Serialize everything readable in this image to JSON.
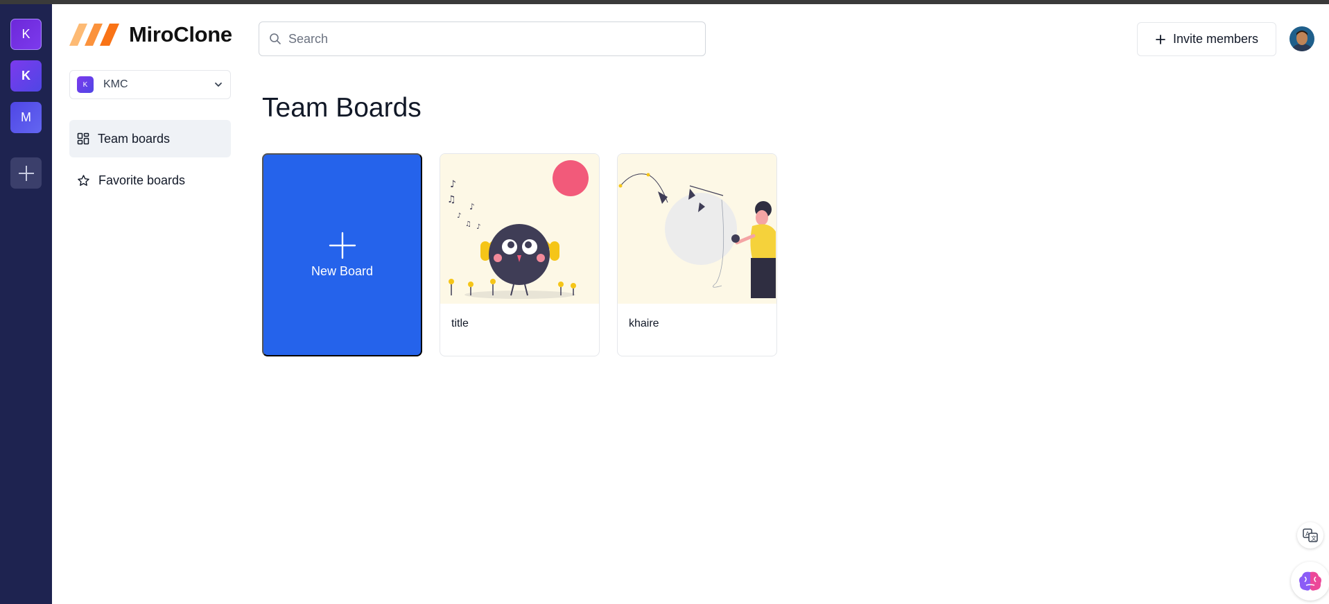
{
  "app": {
    "name": "MiroClone"
  },
  "org_rail": {
    "orgs": [
      {
        "initial": "K"
      },
      {
        "initial": "K"
      },
      {
        "initial": "M"
      }
    ],
    "add_label": "+"
  },
  "org_switcher": {
    "initial": "K",
    "name": "KMC"
  },
  "nav": {
    "team_boards": "Team boards",
    "favorite_boards": "Favorite boards"
  },
  "search": {
    "placeholder": "Search",
    "value": ""
  },
  "header": {
    "invite_label": "Invite members"
  },
  "main": {
    "title": "Team Boards",
    "new_board_label": "New Board",
    "boards": [
      {
        "title": "title"
      },
      {
        "title": "khaire"
      }
    ]
  },
  "colors": {
    "rail": "#1e2350",
    "accent": "#2563eb",
    "logo_orange": "#f97316",
    "card_thumb_bg": "#fdf8e6"
  },
  "icons": {
    "search": "search-icon",
    "chevron": "chevron-down-icon",
    "team": "dashboard-icon",
    "favorite": "star-icon",
    "plus": "plus-icon",
    "translate": "translate-icon",
    "ai": "brain-icon"
  }
}
